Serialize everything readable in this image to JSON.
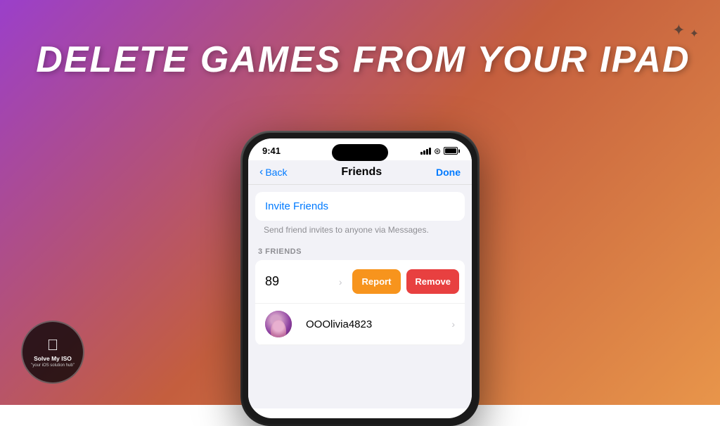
{
  "background": {
    "gradient": "purple-orange"
  },
  "title": {
    "text": "DELETE GAMES FROM YOUR IPAD"
  },
  "phone": {
    "status_bar": {
      "time": "9:41",
      "signal": "full",
      "wifi": true,
      "battery": "full"
    },
    "nav": {
      "back_label": "Back",
      "title": "Friends",
      "done_label": "Done"
    },
    "invite_section": {
      "title": "Invite Friends",
      "subtitle": "Send friend invites to anyone via Messages."
    },
    "friends_header": "3 FRIENDS",
    "friend_row_swiped": {
      "number": "89",
      "report_label": "Report",
      "remove_label": "Remove"
    },
    "friend_olivia": {
      "name": "OOOlivia4823"
    }
  },
  "logo": {
    "apple_symbol": "",
    "main_text": "Solve My ISO",
    "sub_text": "\"your iOS solution hub\""
  },
  "decorations": {
    "stars": [
      "✦",
      "✦"
    ]
  }
}
